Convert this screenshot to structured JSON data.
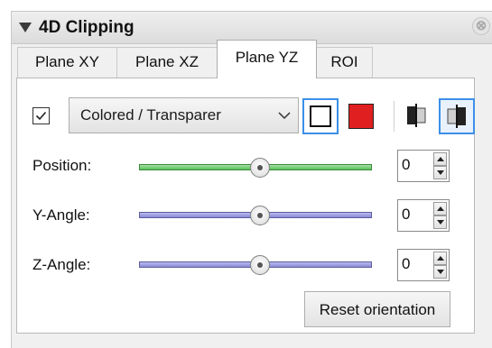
{
  "panel": {
    "title": "4D Clipping",
    "close_glyph": "⊗"
  },
  "tabs": [
    {
      "label": "Plane XY",
      "active": false
    },
    {
      "label": "Plane XZ",
      "active": false
    },
    {
      "label": "Plane YZ",
      "active": true
    },
    {
      "label": "ROI",
      "active": false
    }
  ],
  "toolbar": {
    "checkbox_checked": true,
    "render_mode": "Colored / Transparer",
    "colors": {
      "outline": "#ffffff",
      "fill": "#e02020",
      "selected_accent": "#3c8fe8"
    },
    "mode_icons": [
      "clip-side-a-icon",
      "clip-side-b-icon"
    ]
  },
  "rows": [
    {
      "label": "Position:",
      "value": "0",
      "slider_position": 0.52,
      "track_color": "green"
    },
    {
      "label": "Y-Angle:",
      "value": "0",
      "slider_position": 0.52,
      "track_color": "blue"
    },
    {
      "label": "Z-Angle:",
      "value": "0",
      "slider_position": 0.52,
      "track_color": "blue"
    }
  ],
  "reset_label": "Reset orientation"
}
